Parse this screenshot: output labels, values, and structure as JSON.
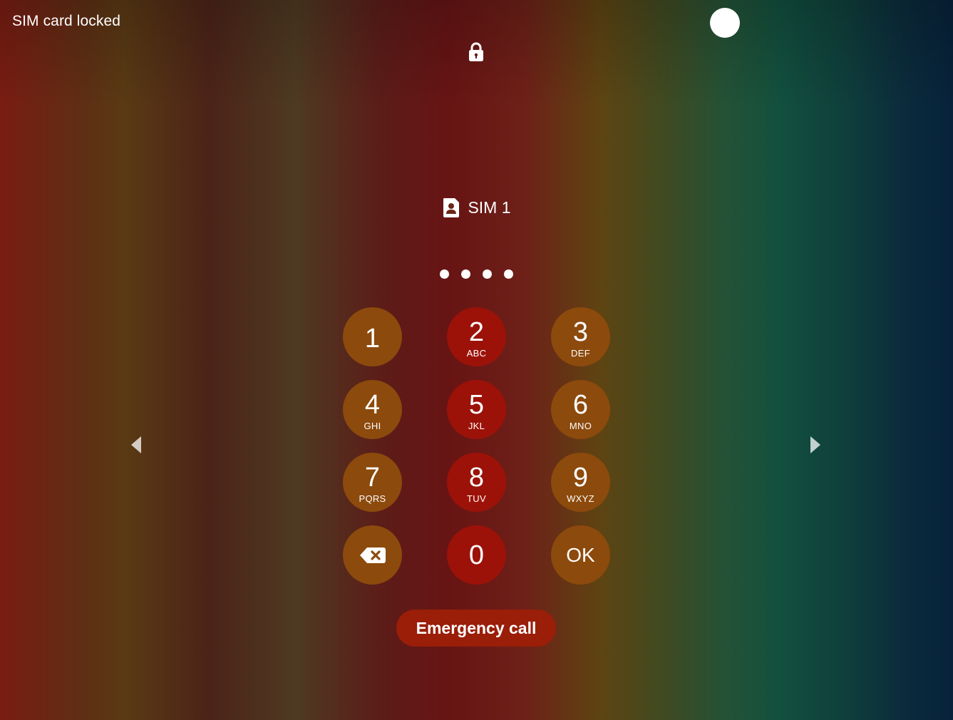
{
  "status_bar": {
    "carrier_text": "SIM card locked",
    "indicator_icon": "white-circle"
  },
  "header": {
    "icon": "lock-icon"
  },
  "sim": {
    "icon": "sim-card-icon",
    "label": "SIM 1"
  },
  "pin_entry": {
    "entered_count": 4
  },
  "keypad": {
    "keys": [
      {
        "digit": "1",
        "letters": ""
      },
      {
        "digit": "2",
        "letters": "ABC"
      },
      {
        "digit": "3",
        "letters": "DEF"
      },
      {
        "digit": "4",
        "letters": "GHI"
      },
      {
        "digit": "5",
        "letters": "JKL"
      },
      {
        "digit": "6",
        "letters": "MNO"
      },
      {
        "digit": "7",
        "letters": "PQRS"
      },
      {
        "digit": "8",
        "letters": "TUV"
      },
      {
        "digit": "9",
        "letters": "WXYZ"
      }
    ],
    "backspace_icon": "backspace-icon",
    "zero": "0",
    "ok_label": "OK"
  },
  "emergency_call_label": "Emergency call",
  "navigation": {
    "left_icon": "arrow-left-icon",
    "right_icon": "arrow-right-icon"
  },
  "colors": {
    "key_side": "#8c4a0c",
    "key_mid": "#9c1208",
    "emergency_button": "#9a1e08",
    "text": "#ffffff"
  }
}
